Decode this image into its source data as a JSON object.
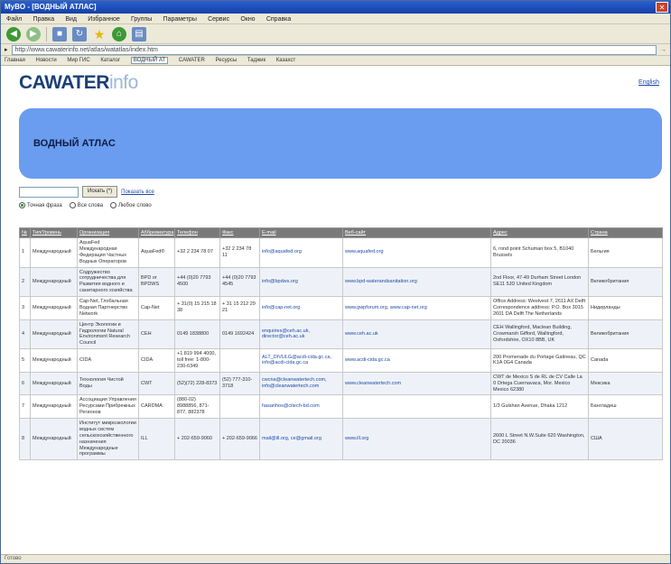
{
  "window": {
    "title": "MyBO - [ВОДНЫЙ АТЛАС]"
  },
  "menu": [
    "Файл",
    "Правка",
    "Вид",
    "Избранное",
    "Группы",
    "Параметры",
    "Сервис",
    "Окно",
    "Справка"
  ],
  "address": {
    "url": "http://www.cawaterinfo.net/atlas/watatlas/index.htm"
  },
  "links": [
    "Главная",
    "Новости",
    "Мир ГИС",
    "Каталог",
    "ВОДНЫЙ АТ",
    "CAWATER",
    "Ресурсы",
    "Таджик",
    "Казахст"
  ],
  "site": {
    "logo_bold": "CAWATER",
    "logo_light": "info",
    "lang_link": "English",
    "banner_title": "ВОДНЫЙ АТЛАС"
  },
  "search": {
    "button_label": "Искать (*)",
    "show_all": "Показать все",
    "options": [
      {
        "label": "Точная фраза",
        "selected": true
      },
      {
        "label": "Все слова",
        "selected": false
      },
      {
        "label": "Любое слово",
        "selected": false
      }
    ]
  },
  "table": {
    "headers": [
      "№",
      "Тип/Уровень",
      "Организация",
      "Аббревиатура",
      "Телефон",
      "Факс",
      "E-mail",
      "Веб-сайт",
      "Адрес",
      "Страна"
    ],
    "rows": [
      [
        "1",
        "Международный",
        "AquaFed Международная Федерация Частных Водных Операторов",
        "AquaFed®",
        "+32 2 234 78 07",
        "+32 2 234 78 11",
        "info@aquafed.org",
        "www.aquafed.org",
        "6, rond point Schuman box 5, B1040 Brussels",
        "Бельгия"
      ],
      [
        "2",
        "Международный",
        "Содружество сотрудничества для Развития водного и санитарного хозяйства",
        "BPD or BPDWS",
        "+44 (0)20 7793 4500",
        "+44 (0)20 7793 4545",
        "info@bpdws.org",
        "www.bpd-waterandsanitation.org",
        "2nd Floor, 47-49 Durham Street London SE11 5JD United Kingdom",
        "Великобритания"
      ],
      [
        "3",
        "Международный",
        "Cap-Net, Глобальная Водная Партнерство Network",
        "Cap-Net",
        "+ 31(0) 15 215 18 38",
        "+ 31 15 212 29 21",
        "info@cap-net.org",
        "www.gwpforum.org, www.cap-net.org",
        "Office Address: Westvest 7, 2611 AX Delft Correspondence address: P.O. Box 3015 2601 DA Delft The Netherlands",
        "Нидерланды"
      ],
      [
        "4",
        "Международный",
        "Центр Экологии и Гидрологии Natural Environment Research Council",
        "CEH",
        "0149 1838800",
        "0149 1692424",
        "enquiries@ceh.ac.uk, director@ceh.ac.uk",
        "www.ceh.ac.uk",
        "CEH Wallingford, Maclean Building, Crowmarsh Gifford, Wallingford, Oxfordshire, OX10 8BB, UK",
        "Великобритания"
      ],
      [
        "5",
        "Международный",
        "CIDA",
        "CIDA",
        "+1 819 994 4000, toll free: 1-800-230-6349",
        "",
        "ALT_DIVULG@acdi-cida.gc.ca, info@acdi-cida.gc.ca",
        "www.acdi-cida.gc.ca",
        "200 Promenade du Portage Gatineau, QC K1A 0G4 Canada",
        "Canada"
      ],
      [
        "6",
        "Международный",
        "Технология Чистой Воды",
        "CWT",
        "(52)(72) 228-8373",
        "(52) 777-310-3718",
        "cwcna@cleanwatertech.com, info@cleanwatertech.com",
        "www.cleanwatertech.com",
        "CWT de Mexico S de RL de CV Calle La 0 Ortega Cuernavaca, Mor. Mexico Mexico 62380",
        "Мексика"
      ],
      [
        "7",
        "Международный",
        "Ассоциация Управления Ресурсами Прибрежных Регионов",
        "CARDMA",
        "(880-02) 8988856, 871-877, 882378",
        "",
        "hasanhos@citech-bd.com",
        "",
        "1/3 Gulshan Avenue, Dhaka 1212",
        "Бангладеш"
      ],
      [
        "8",
        "Международный",
        "Институт микроэкологии водных систем сельскохозяйственного назначения Международные программы",
        "ILL",
        "+ 202-659-9060",
        "+ 202-659-9066",
        "mail@ill.org, ce@gmail.org",
        "www.ill.org",
        "2600 L Street N.W.Suite 620 Washington, DC 20036",
        "США"
      ]
    ]
  },
  "status": "Готово"
}
